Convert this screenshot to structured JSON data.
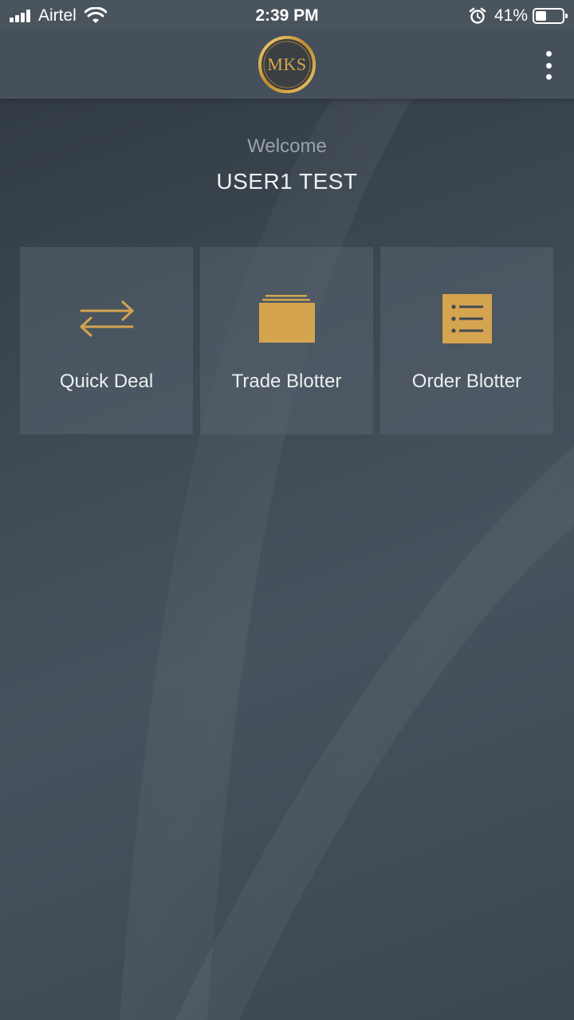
{
  "status_bar": {
    "carrier": "Airtel",
    "time": "2:39 PM",
    "battery_percent_label": "41%",
    "battery_level": 0.41,
    "icons": [
      "signal-icon",
      "wifi-icon",
      "alarm-icon",
      "battery-icon"
    ]
  },
  "header": {
    "logo_text": "MKS",
    "menu_icon": "more-vertical-icon"
  },
  "welcome": {
    "greeting": "Welcome",
    "user_name": "USER1 TEST"
  },
  "tiles": [
    {
      "label": "Quick Deal",
      "icon": "swap-arrows-icon"
    },
    {
      "label": "Trade Blotter",
      "icon": "folder-stack-icon"
    },
    {
      "label": "Order Blotter",
      "icon": "list-icon"
    }
  ],
  "colors": {
    "accent_gold": "#d4a44f",
    "status_bar_bg": "#4a545d",
    "header_bg": "#46505a",
    "tile_bg": "#56626e"
  }
}
